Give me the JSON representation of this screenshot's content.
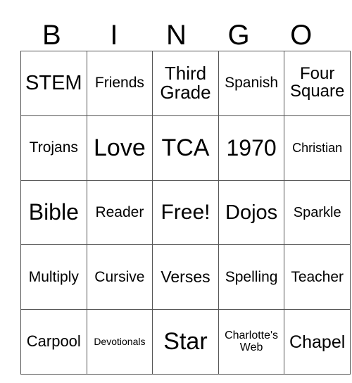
{
  "card": {
    "header_letters": [
      "B",
      "I",
      "N",
      "G",
      "O"
    ],
    "columns": 5,
    "rows": 5,
    "free_space_label": "Free!",
    "free_space_position": {
      "row": 3,
      "column": 3
    },
    "border_color": "#555555",
    "background_color": "#ffffff",
    "text_color": "#000000",
    "grid": [
      [
        {
          "label": "STEM",
          "font_size": "29px"
        },
        {
          "label": "Friends",
          "font_size": "21px"
        },
        {
          "label": "Third Grade",
          "font_size": "26px"
        },
        {
          "label": "Spanish",
          "font_size": "21px"
        },
        {
          "label": "Four Square",
          "font_size": "24px"
        }
      ],
      [
        {
          "label": "Trojans",
          "font_size": "21px"
        },
        {
          "label": "Love",
          "font_size": "34px"
        },
        {
          "label": "TCA",
          "font_size": "34px"
        },
        {
          "label": "1970",
          "font_size": "32px"
        },
        {
          "label": "Christian",
          "font_size": "18px"
        }
      ],
      [
        {
          "label": "Bible",
          "font_size": "32px"
        },
        {
          "label": "Reader",
          "font_size": "21px"
        },
        {
          "label": "Free!",
          "font_size": "30px"
        },
        {
          "label": "Dojos",
          "font_size": "29px"
        },
        {
          "label": "Sparkle",
          "font_size": "20px"
        }
      ],
      [
        {
          "label": "Multiply",
          "font_size": "21px"
        },
        {
          "label": "Cursive",
          "font_size": "21px"
        },
        {
          "label": "Verses",
          "font_size": "23px"
        },
        {
          "label": "Spelling",
          "font_size": "21px"
        },
        {
          "label": "Teacher",
          "font_size": "21px"
        }
      ],
      [
        {
          "label": "Carpool",
          "font_size": "22px"
        },
        {
          "label": "Devotionals",
          "font_size": "14px"
        },
        {
          "label": "Star",
          "font_size": "34px"
        },
        {
          "label": "Charlotte's Web",
          "font_size": "16px"
        },
        {
          "label": "Chapel",
          "font_size": "25px"
        }
      ]
    ]
  }
}
